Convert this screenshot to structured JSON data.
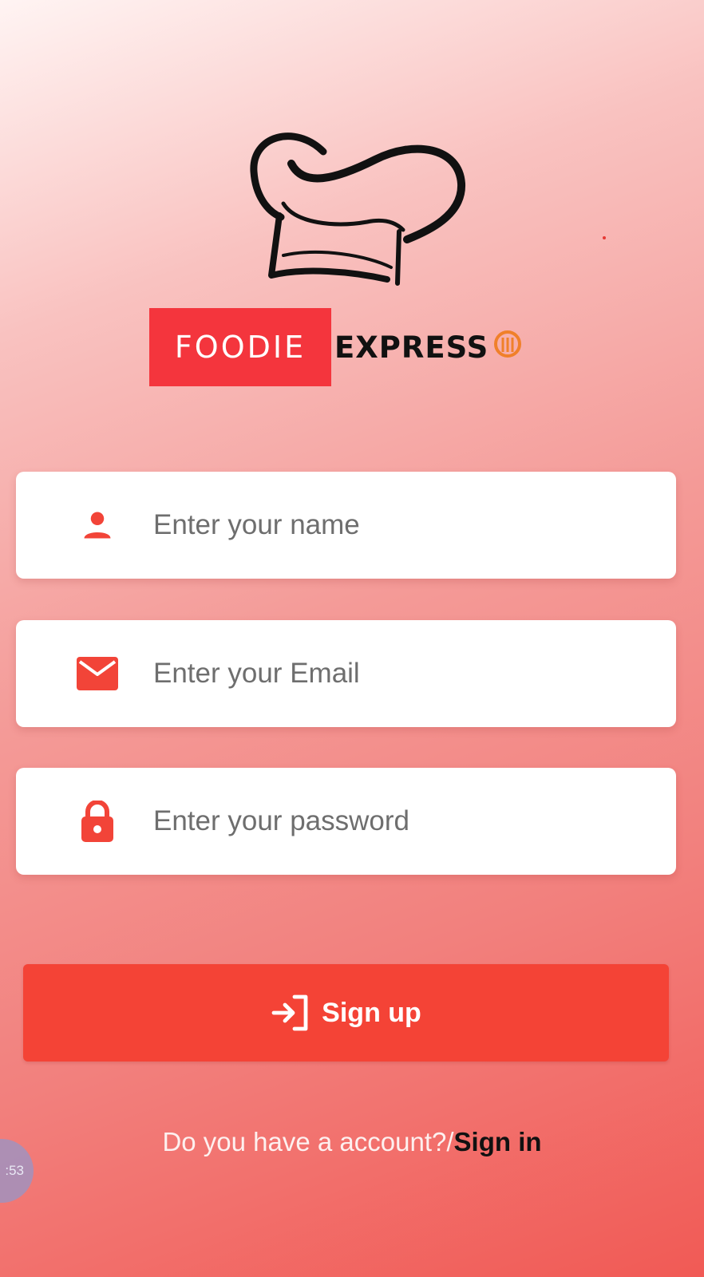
{
  "brand": {
    "name_part1": "FOODIE",
    "name_part2": "EXPRESS",
    "accent_color": "#f4353d",
    "logo_icon": "chef-hat-icon"
  },
  "form": {
    "name_field": {
      "placeholder": "Enter your name",
      "value": "",
      "icon": "person-icon"
    },
    "email_field": {
      "placeholder": "Enter your Email",
      "value": "",
      "icon": "mail-icon"
    },
    "password_field": {
      "placeholder": "Enter your password",
      "value": "",
      "icon": "lock-icon"
    }
  },
  "signup_button": {
    "label": "Sign up",
    "icon": "login-arrow-icon",
    "color": "#f44336"
  },
  "footer": {
    "question": "Do you have a account?/",
    "signin_label": "Sign in"
  },
  "overlay": {
    "timer_text": ":53"
  }
}
